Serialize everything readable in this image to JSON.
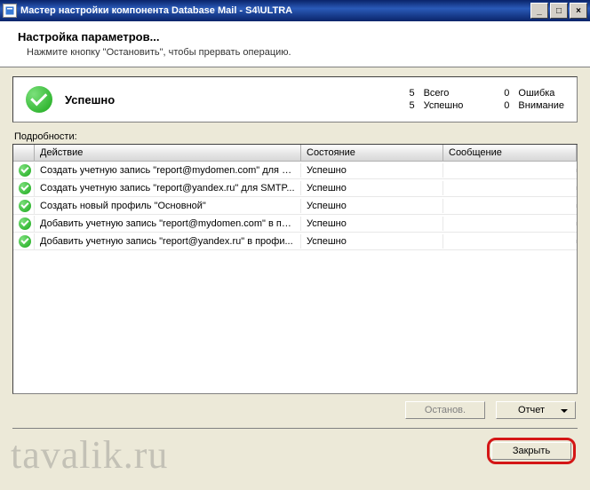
{
  "window": {
    "title": "Мастер настройки компонента Database Mail - S4\\ULTRA"
  },
  "header": {
    "title": "Настройка параметров...",
    "subtitle": "Нажмите кнопку \"Остановить\", чтобы прервать операцию."
  },
  "summary": {
    "status_text": "Успешно",
    "stats_left": [
      {
        "num": "5",
        "label": "Всего"
      },
      {
        "num": "5",
        "label": "Успешно"
      }
    ],
    "stats_right": [
      {
        "num": "0",
        "label": "Ошибка"
      },
      {
        "num": "0",
        "label": "Внимание"
      }
    ]
  },
  "details": {
    "label": "Подробности:",
    "columns": {
      "action": "Действие",
      "state": "Состояние",
      "message": "Сообщение"
    },
    "rows": [
      {
        "action": "Создать учетную запись \"report@mydomen.com\" для S...",
        "state": "Успешно",
        "message": ""
      },
      {
        "action": "Создать учетную запись \"report@yandex.ru\" для SMTP...",
        "state": "Успешно",
        "message": ""
      },
      {
        "action": "Создать новый профиль \"Основной\"",
        "state": "Успешно",
        "message": ""
      },
      {
        "action": "Добавить учетную запись \"report@mydomen.com\" в пр...",
        "state": "Успешно",
        "message": ""
      },
      {
        "action": "Добавить учетную запись \"report@yandex.ru\" в профи...",
        "state": "Успешно",
        "message": ""
      }
    ]
  },
  "buttons": {
    "stop": "Останов.",
    "report": "Отчет",
    "close": "Закрыть"
  },
  "watermark": "tavalik.ru"
}
